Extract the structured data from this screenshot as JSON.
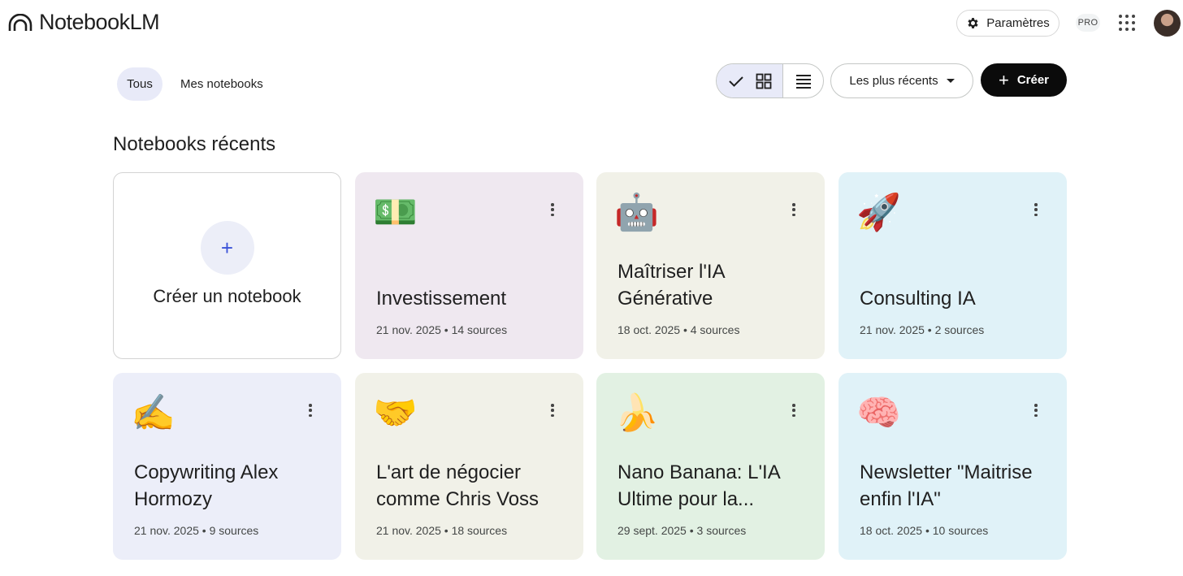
{
  "header": {
    "app_name": "NotebookLM",
    "settings_label": "Paramètres",
    "plan_badge": "PRO",
    "icons": {
      "logo": "notebooklm-logo-icon",
      "settings": "gear-icon",
      "apps": "apps-grid-icon",
      "avatar": "user-avatar"
    }
  },
  "filters": {
    "tabs": [
      {
        "label": "Tous",
        "selected": true
      },
      {
        "label": "Mes notebooks",
        "selected": false
      }
    ]
  },
  "toolbar": {
    "view_modes": [
      {
        "name": "grid",
        "selected": true,
        "icons": [
          "check-icon",
          "grid-icon"
        ]
      },
      {
        "name": "list",
        "selected": false,
        "icons": [
          "list-icon"
        ]
      }
    ],
    "sort_label": "Les plus récents",
    "create_label": "Créer"
  },
  "section": {
    "title": "Notebooks récents"
  },
  "new_notebook": {
    "label": "Créer un notebook"
  },
  "notebooks": [
    {
      "emoji": "💵",
      "title": "Investissement",
      "meta": "21 nov. 2025 • 14 sources",
      "color": "#efe8f0"
    },
    {
      "emoji": "🤖",
      "title": "Maîtriser l'IA Générative",
      "meta": "18 oct. 2025 • 4 sources",
      "color": "#f1f1e8"
    },
    {
      "emoji": "🚀",
      "title": "Consulting IA",
      "meta": "21 nov. 2025 • 2 sources",
      "color": "#e0f2f8"
    },
    {
      "emoji": "✍️",
      "title": "Copywriting Alex Hormozy",
      "meta": "21 nov. 2025 • 9 sources",
      "color": "#eceef9"
    },
    {
      "emoji": "🤝",
      "title": "L'art de négocier comme Chris Voss",
      "meta": "21 nov. 2025 • 18 sources",
      "color": "#f1f1e8"
    },
    {
      "emoji": "🍌",
      "title": "Nano Banana: L'IA Ultime pour la...",
      "meta": "29 sept. 2025 • 3 sources",
      "color": "#e2f1e3"
    },
    {
      "emoji": "🧠",
      "title": "Newsletter \"Maitrise enfin l'IA\"",
      "meta": "18 oct. 2025 • 10 sources",
      "color": "#e0f2f8"
    }
  ]
}
